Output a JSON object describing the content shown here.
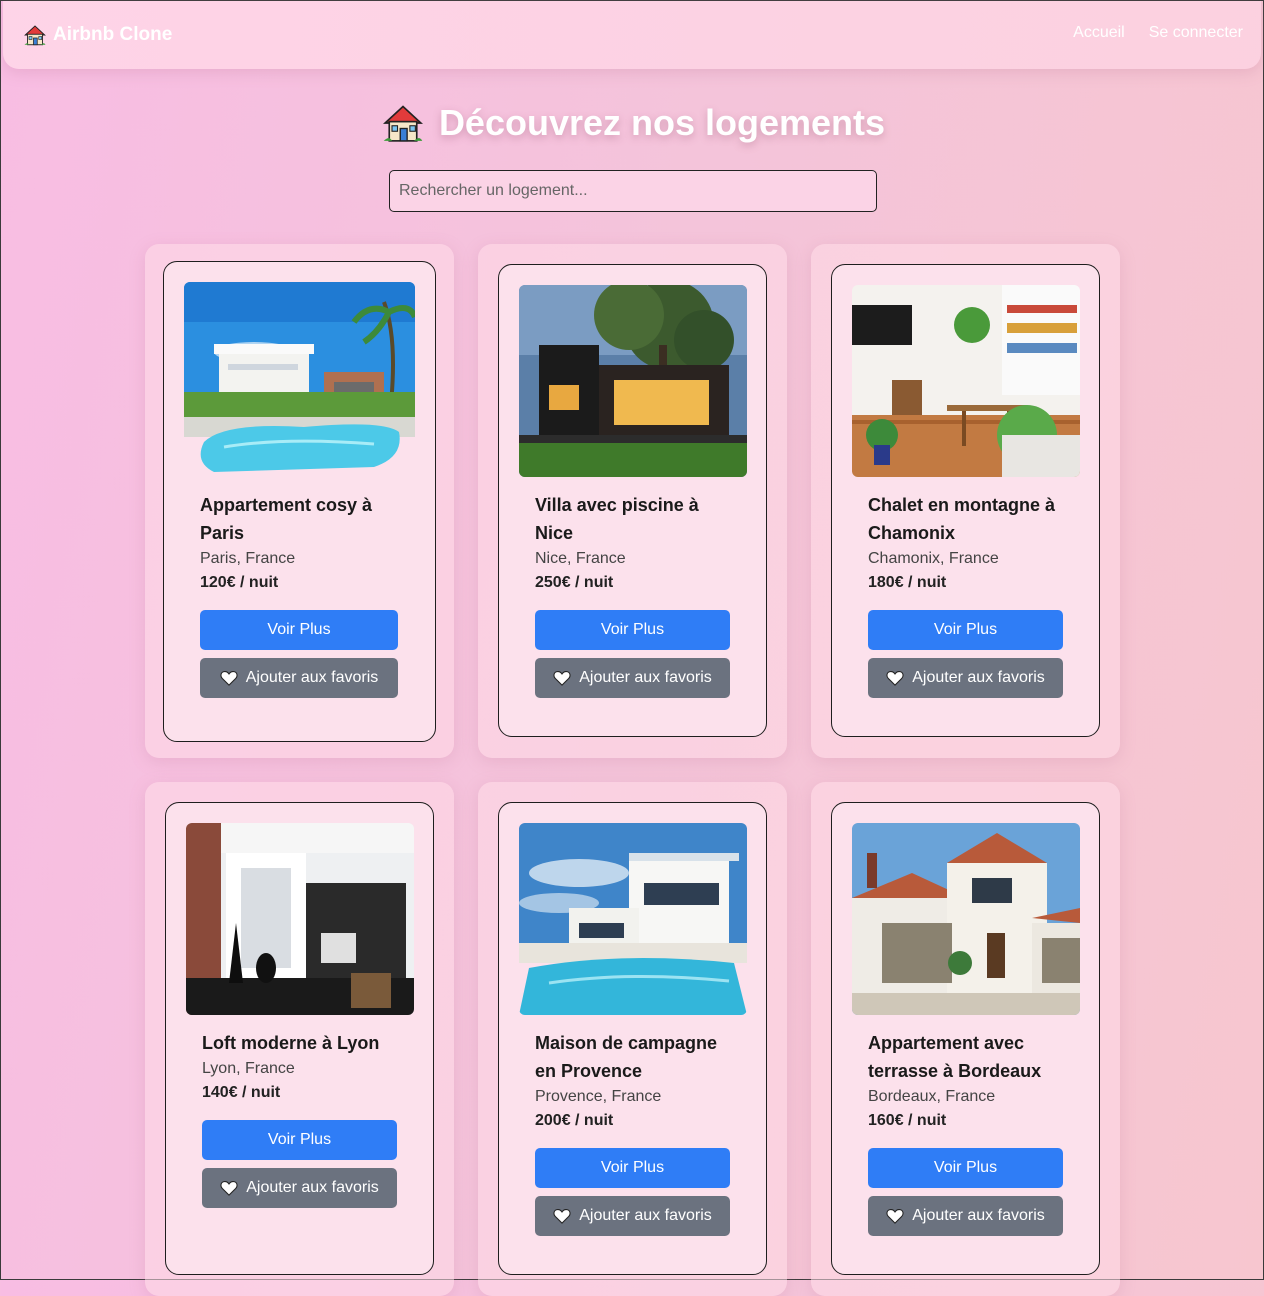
{
  "brand": {
    "name": "Airbnb Clone",
    "icon": "house-emoji-icon"
  },
  "nav": {
    "home": "Accueil",
    "login": "Se connecter"
  },
  "page": {
    "title": "Découvrez nos logements",
    "title_icon": "house-emoji-icon"
  },
  "search": {
    "placeholder": "Rechercher un logement...",
    "value": ""
  },
  "buttons": {
    "more": "Voir Plus",
    "favorite": "Ajouter aux favoris",
    "favorite_icon": "heart-icon"
  },
  "colors": {
    "primary": "#2f7df6",
    "secondary": "#6b727f"
  },
  "listings": [
    {
      "title": "Appartement cosy à Paris",
      "location": "Paris, France",
      "price": "120€ / nuit",
      "photo": "pool-villa-photo"
    },
    {
      "title": "Villa avec piscine à Nice",
      "location": "Nice, France",
      "price": "250€ / nuit",
      "photo": "modern-house-night-photo"
    },
    {
      "title": "Chalet en montagne à Chamonix",
      "location": "Chamonix, France",
      "price": "180€ / nuit",
      "photo": "living-room-photo"
    },
    {
      "title": "Loft moderne à Lyon",
      "location": "Lyon, France",
      "price": "140€ / nuit",
      "photo": "loft-interior-photo"
    },
    {
      "title": "Maison de campagne en Provence",
      "location": "Provence, France",
      "price": "200€ / nuit",
      "photo": "white-villa-pool-photo"
    },
    {
      "title": "Appartement avec terrasse à Bordeaux",
      "location": "Bordeaux, France",
      "price": "160€ / nuit",
      "photo": "suburban-house-photo"
    }
  ]
}
